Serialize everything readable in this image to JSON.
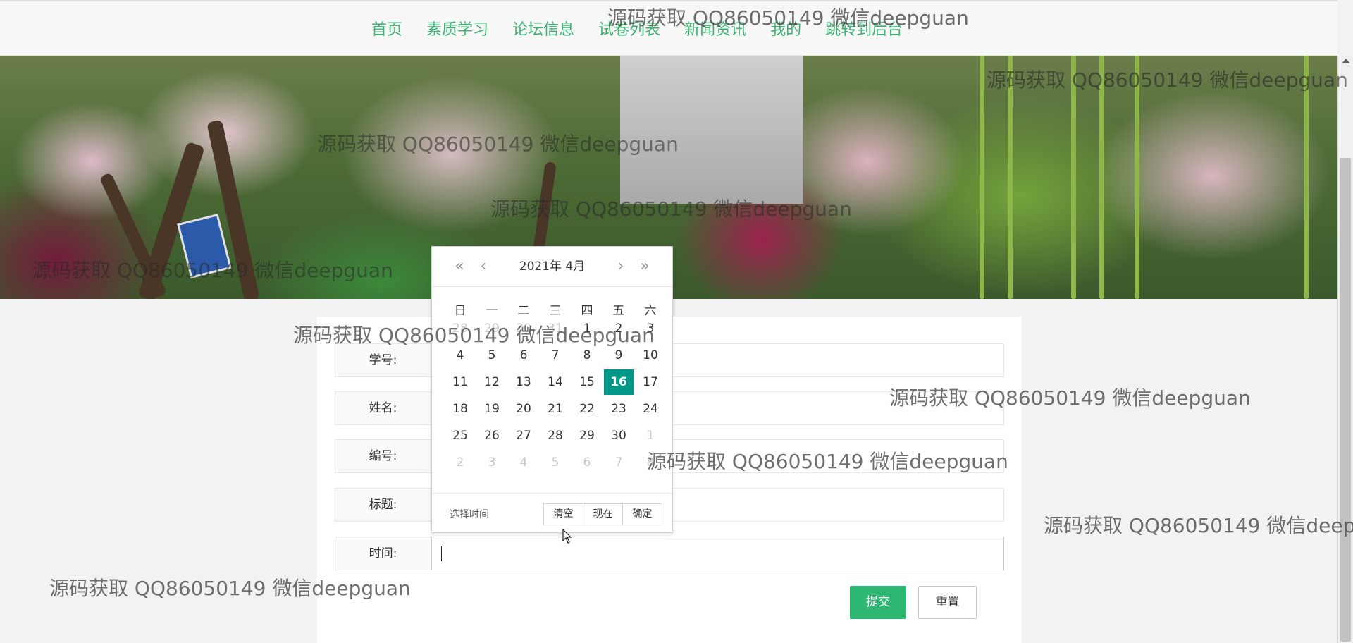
{
  "nav": {
    "items": [
      "首页",
      "素质学习",
      "论坛信息",
      "试卷列表",
      "新闻资讯",
      "我的",
      "跳转到后台"
    ]
  },
  "form": {
    "fields": [
      {
        "label": "学号:",
        "value": ""
      },
      {
        "label": "姓名:",
        "value": ""
      },
      {
        "label": "编号:",
        "value": ""
      },
      {
        "label": "标题:",
        "value": ""
      },
      {
        "label": "时间:",
        "value": ""
      }
    ],
    "submit_label": "提交",
    "reset_label": "重置"
  },
  "datepicker": {
    "year_label": "2021年",
    "month_label": "4月",
    "prev_year_icon": "«",
    "prev_month_icon": "‹",
    "next_month_icon": "›",
    "next_year_icon": "»",
    "weekdays": [
      "日",
      "一",
      "二",
      "三",
      "四",
      "五",
      "六"
    ],
    "days": [
      [
        "28",
        "29",
        "30",
        "31",
        "1",
        "2",
        "3"
      ],
      [
        "4",
        "5",
        "6",
        "7",
        "8",
        "9",
        "10"
      ],
      [
        "11",
        "12",
        "13",
        "14",
        "15",
        "16",
        "17"
      ],
      [
        "18",
        "19",
        "20",
        "21",
        "22",
        "23",
        "24"
      ],
      [
        "25",
        "26",
        "27",
        "28",
        "29",
        "30",
        "1"
      ],
      [
        "2",
        "3",
        "4",
        "5",
        "6",
        "7",
        "8"
      ]
    ],
    "selected_day": "16",
    "choose_time_label": "选择时间",
    "clear_label": "清空",
    "now_label": "现在",
    "confirm_label": "确定"
  },
  "watermark": {
    "text": "源码获取 QQ86050149 微信deepguan"
  },
  "colors": {
    "nav_text": "#3cb371",
    "selected_day_bg": "#009688",
    "submit_bg": "#2eb872"
  }
}
